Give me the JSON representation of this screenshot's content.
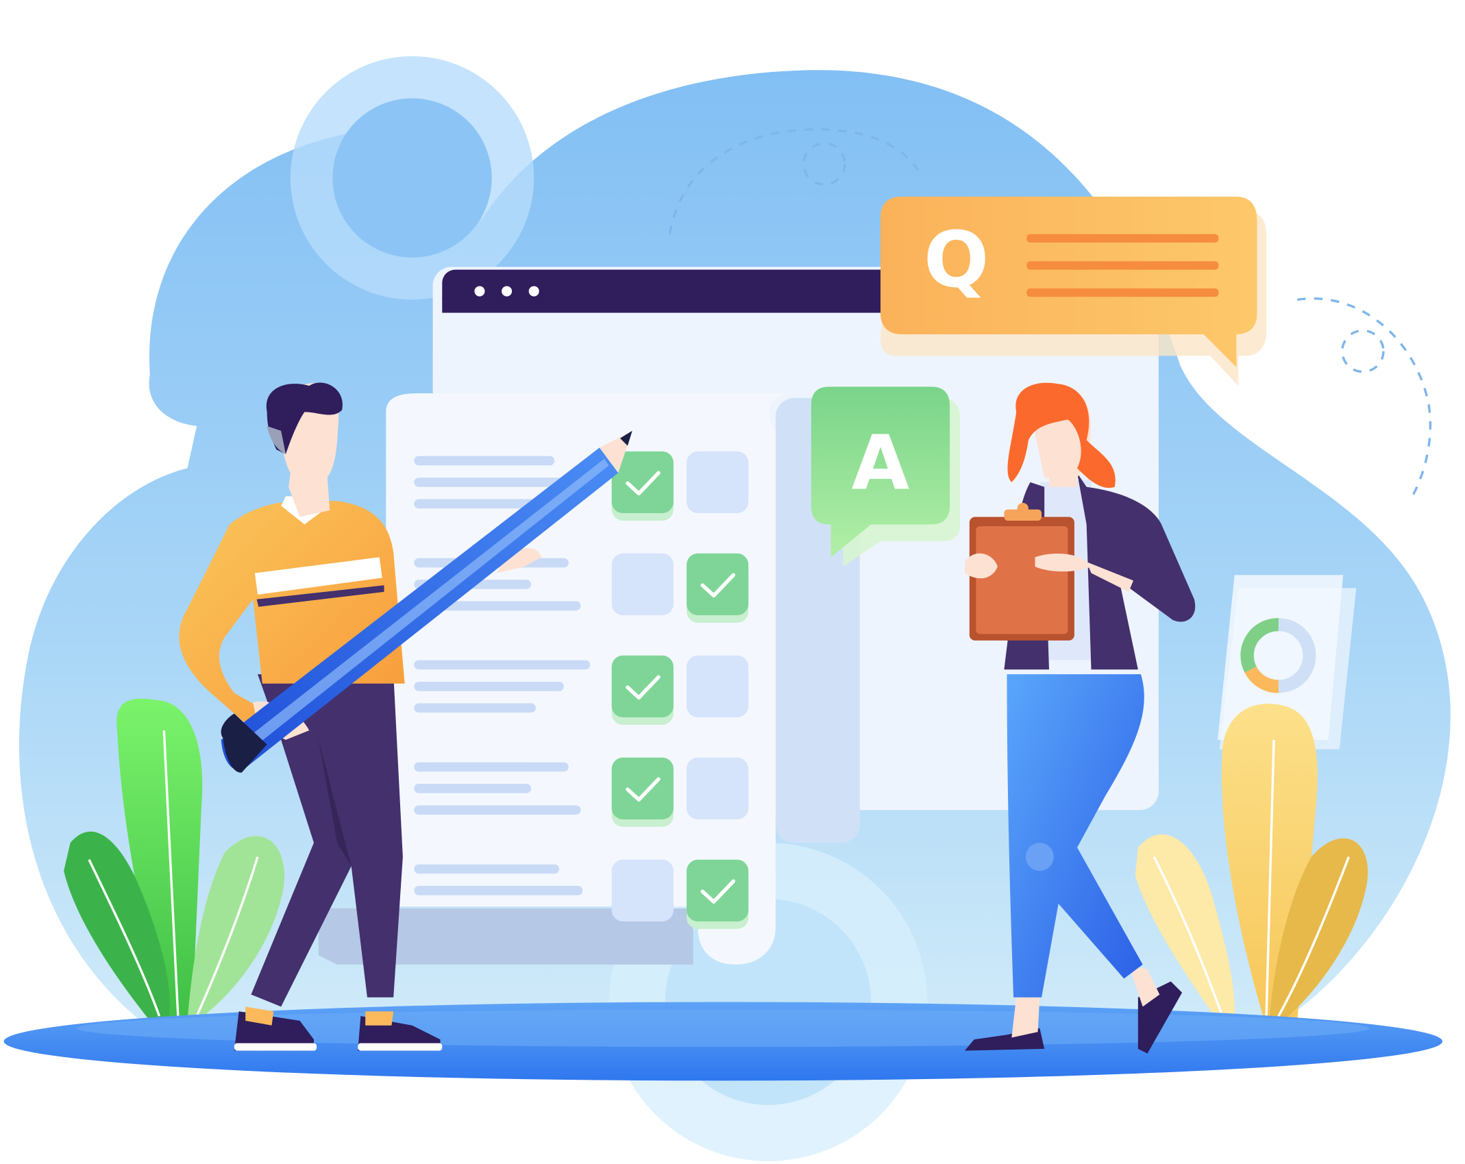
{
  "question_bubble": {
    "letter": "Q"
  },
  "answer_bubble": {
    "letter": "A"
  },
  "checklist": {
    "rows": [
      {
        "left_checked": true,
        "right_checked": false
      },
      {
        "left_checked": false,
        "right_checked": true
      },
      {
        "left_checked": true,
        "right_checked": false
      },
      {
        "left_checked": true,
        "right_checked": false
      },
      {
        "left_checked": false,
        "right_checked": true
      }
    ]
  },
  "colors": {
    "blob": "#8cc4f5",
    "window_bar": "#2f1d5c",
    "check_green": "#7fd597",
    "question_orange": "#fbb95b",
    "answer_green": "#8fe08f",
    "ground": "#3f86f2"
  }
}
